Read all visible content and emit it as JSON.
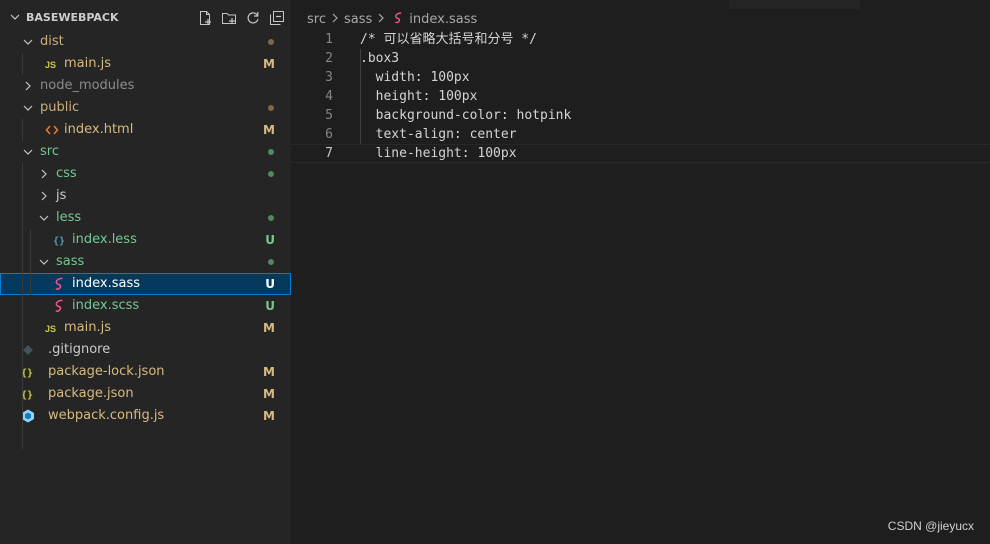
{
  "explorer": {
    "title": "BASEWEBPACK",
    "actions": [
      "new-file-icon",
      "new-folder-icon",
      "refresh-icon",
      "collapse-all-icon"
    ],
    "items": [
      {
        "name": "dist",
        "type": "folder",
        "open": true,
        "depth": 0,
        "color": "#c9b07b",
        "status": "dot",
        "status_color": "#7a6b46"
      },
      {
        "name": "main.js",
        "type": "js",
        "depth": 1,
        "color": "#d7ba7d",
        "status": "M",
        "status_color": "#d7ba7d"
      },
      {
        "name": "node_modules",
        "type": "folder",
        "open": false,
        "depth": 0,
        "color": "#8c8c8c",
        "status": "",
        "status_color": ""
      },
      {
        "name": "public",
        "type": "folder",
        "open": true,
        "depth": 0,
        "color": "#c9b07b",
        "status": "dot",
        "status_color": "#7a6b46"
      },
      {
        "name": "index.html",
        "type": "html",
        "depth": 1,
        "color": "#d7ba7d",
        "status": "M",
        "status_color": "#d7ba7d"
      },
      {
        "name": "src",
        "type": "folder",
        "open": true,
        "depth": 0,
        "color": "#73c991",
        "status": "dot",
        "status_color": "#4e8a60"
      },
      {
        "name": "css",
        "type": "folder",
        "open": false,
        "depth": 1,
        "color": "#73c991",
        "status": "dot",
        "status_color": "#4e8a60"
      },
      {
        "name": "js",
        "type": "folder",
        "open": false,
        "depth": 1,
        "color": "#cccccc",
        "status": "",
        "status_color": ""
      },
      {
        "name": "less",
        "type": "folder",
        "open": true,
        "depth": 1,
        "color": "#73c991",
        "status": "dot",
        "status_color": "#4e8a60"
      },
      {
        "name": "index.less",
        "type": "less",
        "depth": 2,
        "color": "#73c991",
        "status": "U",
        "status_color": "#73c991"
      },
      {
        "name": "sass",
        "type": "folder",
        "open": true,
        "depth": 1,
        "color": "#73c991",
        "status": "dot",
        "status_color": "#4e8a60"
      },
      {
        "name": "index.sass",
        "type": "sass",
        "depth": 2,
        "color": "#ffffff",
        "status": "U",
        "status_color": "#ffffff",
        "selected": true
      },
      {
        "name": "index.scss",
        "type": "sass",
        "depth": 2,
        "color": "#73c991",
        "status": "U",
        "status_color": "#73c991"
      },
      {
        "name": "main.js",
        "type": "js",
        "depth": 1,
        "color": "#d7ba7d",
        "status": "M",
        "status_color": "#d7ba7d"
      },
      {
        "name": ".gitignore",
        "type": "git",
        "depth": 0,
        "color": "#cccccc",
        "status": "",
        "status_color": ""
      },
      {
        "name": "package-lock.json",
        "type": "json",
        "depth": 0,
        "color": "#d7ba7d",
        "status": "M",
        "status_color": "#d7ba7d"
      },
      {
        "name": "package.json",
        "type": "json",
        "depth": 0,
        "color": "#d7ba7d",
        "status": "M",
        "status_color": "#d7ba7d"
      },
      {
        "name": "webpack.config.js",
        "type": "webpack",
        "depth": 0,
        "color": "#d7ba7d",
        "status": "M",
        "status_color": "#d7ba7d"
      }
    ]
  },
  "breadcrumb": {
    "parts": [
      "src",
      "sass"
    ],
    "file": "index.sass"
  },
  "editor": {
    "active_line": 7,
    "lines": [
      {
        "n": "1",
        "text": "/* 可以省略大括号和分号 */"
      },
      {
        "n": "2",
        "text": ".box3"
      },
      {
        "n": "3",
        "text": "  width: 100px"
      },
      {
        "n": "4",
        "text": "  height: 100px"
      },
      {
        "n": "5",
        "text": "  background-color: hotpink"
      },
      {
        "n": "6",
        "text": "  text-align: center"
      },
      {
        "n": "7",
        "text": "  line-height: 100px"
      }
    ]
  },
  "watermark": "CSDN @jieyucx"
}
